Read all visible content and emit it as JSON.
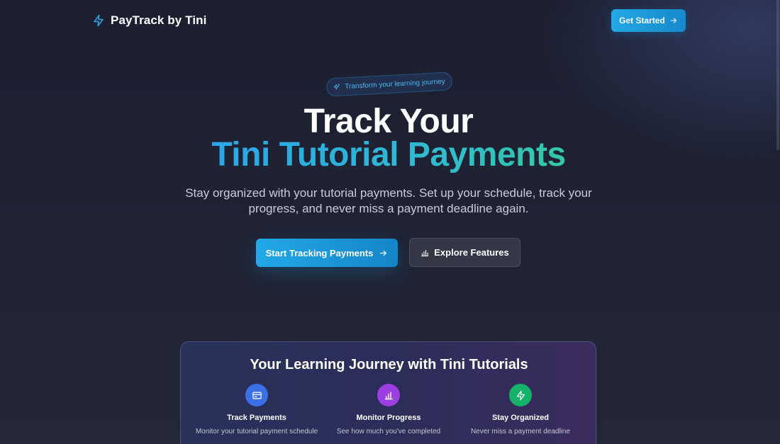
{
  "header": {
    "brand_name": "PayTrack by Tini",
    "cta_label": "Get Started"
  },
  "hero": {
    "badge": "Transform your learning journey",
    "title_line1": "Track Your",
    "title_line2": "Tini Tutorial Payments",
    "subtitle": "Stay organized with your tutorial payments. Set up your schedule, track your progress, and never miss a payment deadline again.",
    "primary_button": "Start Tracking Payments",
    "secondary_button": "Explore Features"
  },
  "journey": {
    "title": "Your Learning Journey with Tini Tutorials",
    "features": [
      {
        "icon": "credit-card-icon",
        "color": "#3b6fe6",
        "title": "Track Payments",
        "description": "Monitor your tutorial payment schedule"
      },
      {
        "icon": "bar-chart-icon",
        "color": "#9b3fe0",
        "title": "Monitor Progress",
        "description": "See how much you've completed"
      },
      {
        "icon": "lightning-icon",
        "color": "#17b26a",
        "title": "Stay Organized",
        "description": "Never miss a payment deadline"
      }
    ]
  },
  "colors": {
    "accent": "#22a8e8",
    "accent_gradient_end": "#35c9a6",
    "background": "#1e2233"
  }
}
